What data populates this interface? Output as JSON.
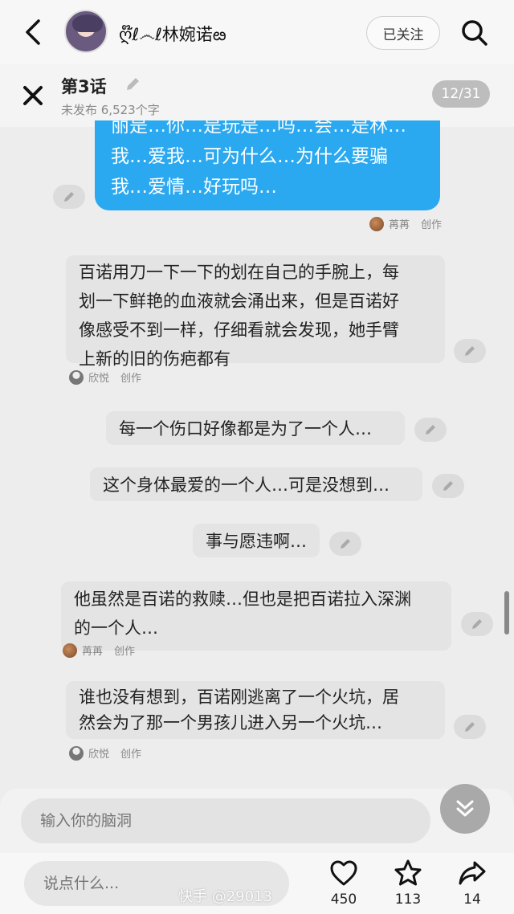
{
  "header": {
    "username": "ღ໊ℓ෴ℓ林婉诺ఴ",
    "follow_label": "已关注"
  },
  "chapter": {
    "title": "第3话",
    "subtitle": "未发布 6,523个字",
    "pager": "12/31"
  },
  "messages": [
    {
      "text_partial": "丽是…你…是玩是…吗…会…是林…",
      "line1": "我…爱我…可为什么…为什么要骗",
      "line2": "我…爱情…好玩吗…"
    },
    {
      "author": "苒苒",
      "role": "创作"
    },
    {
      "line1": "百诺用刀一下一下的划在自己的手腕上，每",
      "line2": "划一下鲜艳的血液就会涌出来，但是百诺好",
      "line3": "像感受不到一样，仔细看就会发现，她手臂",
      "line4": "上新的旧的伤疤都有"
    },
    {
      "author": "欣悦",
      "role": "创作"
    },
    {
      "text": "每一个伤口好像都是为了一个人…"
    },
    {
      "text": "这个身体最爱的一个人…可是没想到…"
    },
    {
      "text": "事与愿违啊…"
    },
    {
      "line1": "他虽然是百诺的救赎…但也是把百诺拉入深渊",
      "line2": "的一个人…"
    },
    {
      "author": "苒苒",
      "role": "创作"
    },
    {
      "line1": "谁也没有想到，百诺刚逃离了一个火坑，居",
      "line2": "然会为了那一个男孩儿进入另一个火坑…"
    },
    {
      "author": "欣悦",
      "role": "创作"
    }
  ],
  "compose": {
    "placeholder": "输入你的脑洞"
  },
  "bottom": {
    "comment_placeholder": "说点什么...",
    "likes": "450",
    "favorites": "113",
    "shares": "14",
    "watermark": "快手 @29013"
  },
  "icons": [
    "back-arrow-icon",
    "search-icon",
    "close-icon",
    "pencil-icon",
    "heart-icon",
    "star-icon",
    "share-icon",
    "chevron-double-down-icon"
  ],
  "colors": {
    "accent_blue": "#2aa8f0",
    "background": "#ededed"
  }
}
